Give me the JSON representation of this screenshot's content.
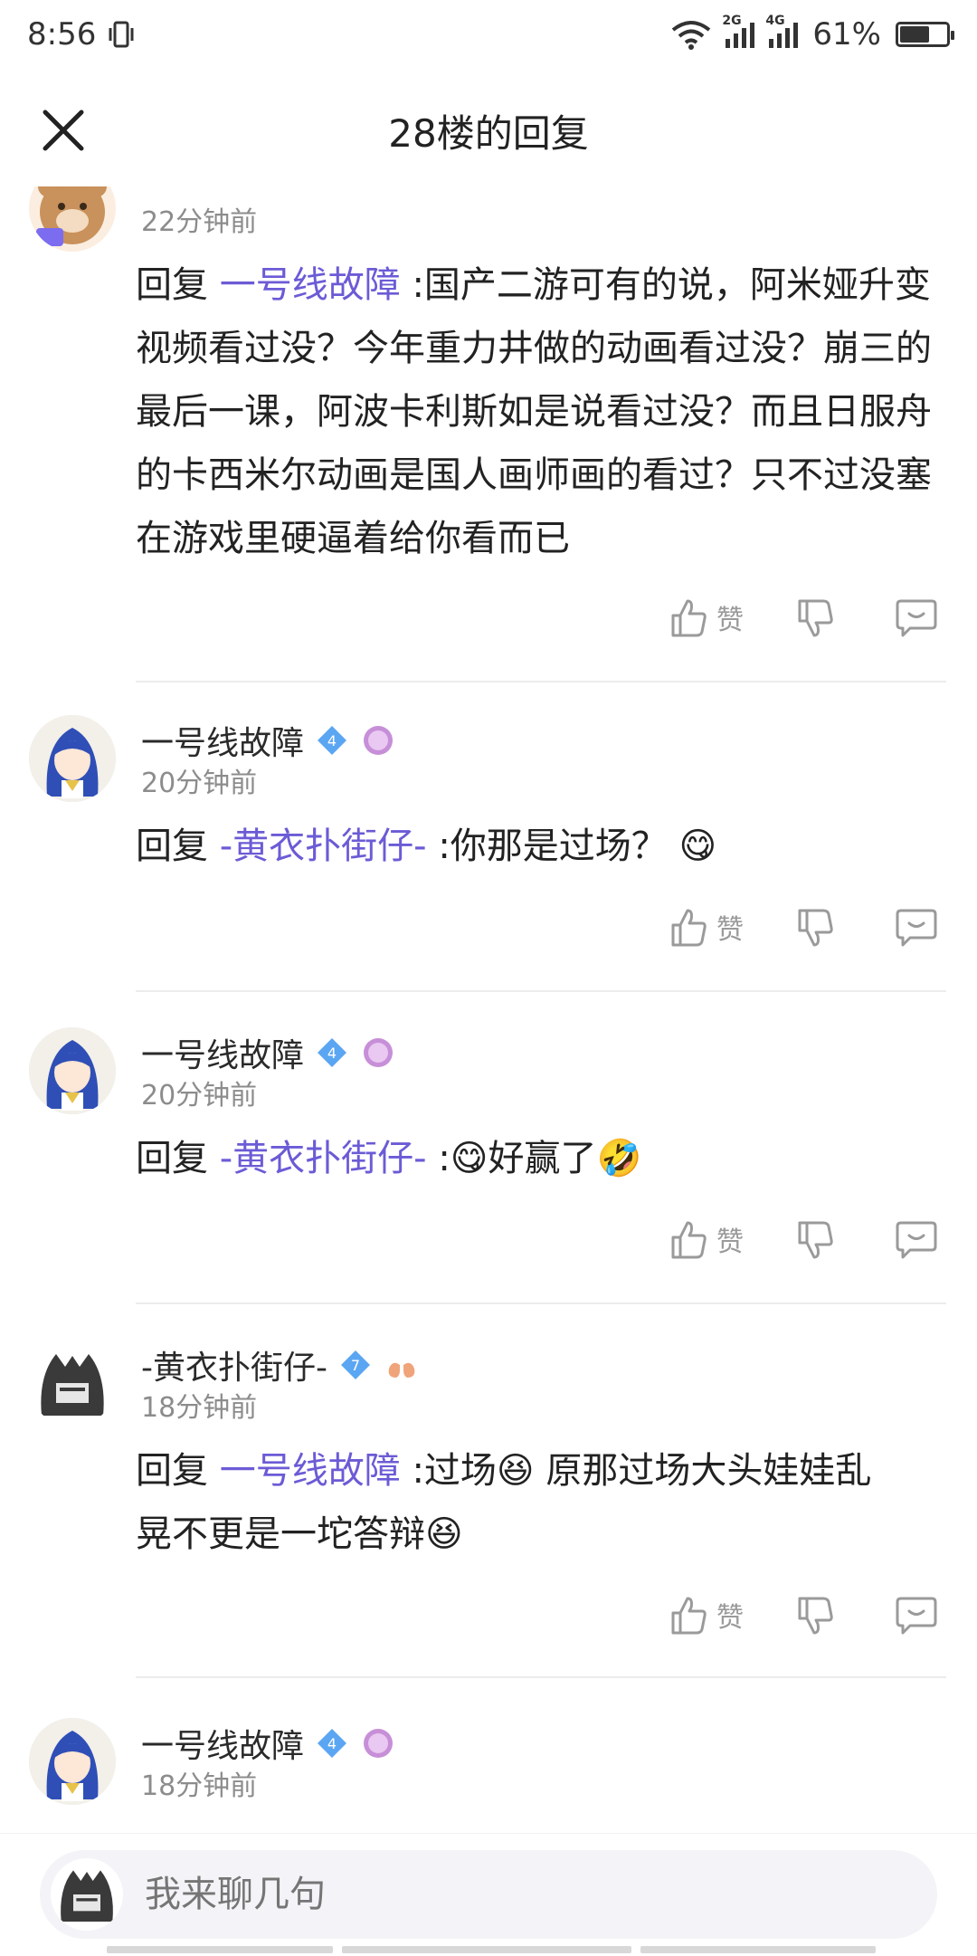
{
  "status_bar": {
    "time": "8:56",
    "net1": "2G",
    "net2": "4G",
    "battery": "61%",
    "battery_level": 0.61
  },
  "header": {
    "title": "28楼的回复"
  },
  "comments": [
    {
      "username": "",
      "time": "22分钟前",
      "reply_prefix": "回复",
      "mention": "一号线故障",
      "text": ":国产二游可有的说，阿米娅升变视频看过没？今年重力井做的动画看过没？崩三的最后一课，阿波卡利斯如是说看过没？而且日服舟的卡西米尔动画是国人画师画的看过？只不过没塞在游戏里硬逼着给你看而已",
      "like_label": "赞"
    },
    {
      "username": "一号线故障",
      "level": "4",
      "time": "20分钟前",
      "reply_prefix": "回复",
      "mention": "-黄衣扑街仔-",
      "text": ":你那是过场？ 😋",
      "like_label": "赞"
    },
    {
      "username": "一号线故障",
      "level": "4",
      "time": "20分钟前",
      "reply_prefix": "回复",
      "mention": "-黄衣扑街仔-",
      "text": ":😋好赢了🤣",
      "like_label": "赞"
    },
    {
      "username": "-黄衣扑街仔-",
      "level": "7",
      "time": "18分钟前",
      "reply_prefix": "回复",
      "mention": "一号线故障",
      "text_a": ":过场😆 原那过场大头娃娃乱",
      "text_b": "晃不更是一坨答辩😆",
      "like_label": "赞"
    },
    {
      "username": "一号线故障",
      "level": "4",
      "time": "18分钟前"
    }
  ],
  "composer": {
    "placeholder": "我来聊几句"
  }
}
